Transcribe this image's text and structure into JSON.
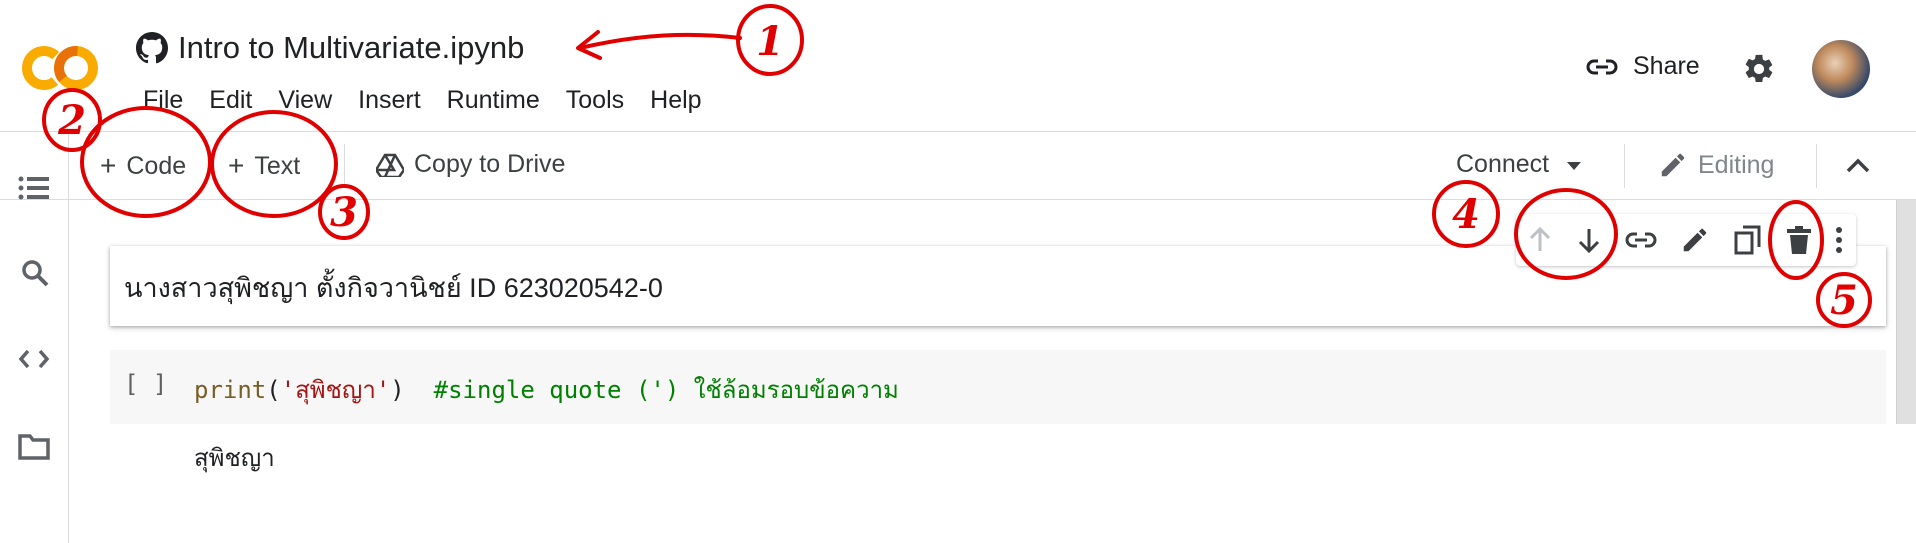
{
  "header": {
    "logo": "CO",
    "title": "Intro to Multivariate.ipynb",
    "share_label": "Share",
    "menu": [
      "File",
      "Edit",
      "View",
      "Insert",
      "Runtime",
      "Tools",
      "Help"
    ]
  },
  "toolbar": {
    "code_label": "Code",
    "text_label": "Text",
    "copy_drive_label": "Copy to Drive",
    "connect_label": "Connect",
    "editing_label": "Editing"
  },
  "cells": {
    "text_cell": "นางสาวสุพิชญา ตั้งกิจวานิชย์ ID 623020542-0",
    "code_gutter": "[ ]",
    "code_fn": "print",
    "code_open": "(",
    "code_str": "'สุพิชญา'",
    "code_close": ")",
    "code_comment": "#single quote (') ใช้ล้อมรอบข้อความ",
    "output": "สุพิชญา"
  },
  "annotations": [
    "1",
    "2",
    "3",
    "4",
    "5"
  ],
  "colors": {
    "annotation_red": "#e00000",
    "logo_orange": "#f9ab00",
    "logo_dark_orange": "#e8710a"
  },
  "icons": [
    "github-icon",
    "link-icon",
    "gear-icon",
    "list-icon",
    "search-icon",
    "code-icon",
    "folder-icon",
    "drive-icon",
    "pencil-icon",
    "chevron-up-icon",
    "arrow-up-icon",
    "arrow-down-icon",
    "trash-icon",
    "more-vert-icon",
    "copy-icon"
  ]
}
